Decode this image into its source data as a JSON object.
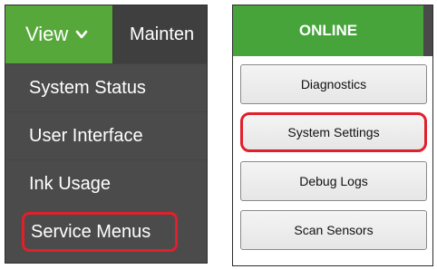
{
  "left_panel": {
    "nav": {
      "view_label": "View",
      "maintenance_label": "Mainten"
    },
    "menu": {
      "items": [
        {
          "label": "System Status"
        },
        {
          "label": "User Interface"
        },
        {
          "label": "Ink Usage"
        },
        {
          "label": "Service Menus"
        }
      ]
    }
  },
  "right_panel": {
    "tab_label": "ONLINE",
    "buttons": [
      {
        "label": "Diagnostics"
      },
      {
        "label": "System Settings"
      },
      {
        "label": "Debug Logs"
      },
      {
        "label": "Scan Sensors"
      }
    ]
  },
  "colors": {
    "accent_green": "#56a83b",
    "menu_bg": "#4b4b4b",
    "highlight_red": "#e0202b"
  },
  "icons": {
    "view_chevron": "chevron-down-icon"
  }
}
